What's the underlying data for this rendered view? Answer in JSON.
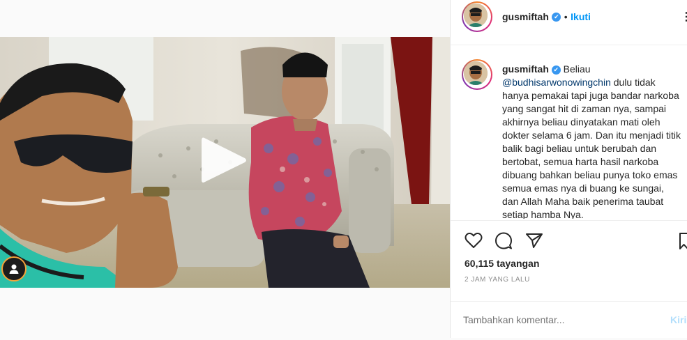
{
  "post": {
    "username": "gusmiftah",
    "verified_mark": "✔",
    "separator": "•",
    "follow_label": "Ikuti",
    "more_icon": "⋮"
  },
  "caption": {
    "username": "gusmiftah",
    "verified_mark": "✔",
    "text_before": "Beliau",
    "mention": "@budhisarwonowingchin",
    "text_after": "dulu tidak hanya pemakai tapi juga bandar narkoba yang sangat hit di zaman nya, sampai akhirnya beliau dinyatakan mati oleh dokter selama 6 jam. Dan itu menjadi titik balik bagi beliau untuk berubah dan bertobat, semua harta hasil narkoba dibuang bahkan beliau punya toko emas semua emas nya di buang ke sungai, dan Allah Maha baik penerima taubat setiap hamba Nya."
  },
  "stats": {
    "views": "60,115 tayangan",
    "timestamp": "2 JAM YANG LALU"
  },
  "comment": {
    "placeholder": "Tambahkan komentar...",
    "post_label": "Kirim"
  },
  "icons": {
    "like": "heart-icon",
    "comment": "comment-icon",
    "share": "share-icon",
    "save": "bookmark-icon",
    "play": "play-icon",
    "user": "user-icon"
  },
  "colors": {
    "link": "#0095f6",
    "mention": "#00376b",
    "verified": "#3897f0",
    "muted": "#8e8e8e"
  }
}
